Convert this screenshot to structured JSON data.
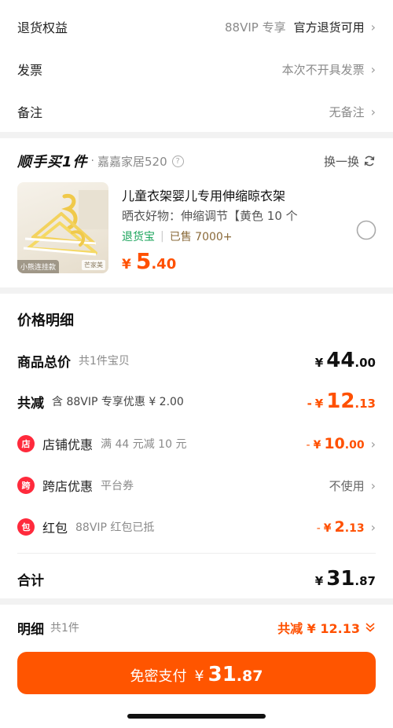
{
  "info": {
    "rows": [
      {
        "label": "退货权益",
        "grey": "88VIP 专享",
        "dark": "官方退货可用"
      },
      {
        "label": "发票",
        "grey": "本次不开具发票"
      },
      {
        "label": "备注",
        "grey": "无备注"
      }
    ]
  },
  "shunshou": {
    "title": "顺手买1件",
    "dot": "·",
    "shop": "嘉嘉家居520",
    "help": "?",
    "switch_label": "换一换",
    "product": {
      "title": "儿童衣架婴儿专用伸缩晾衣架",
      "subtitle": "晒衣好物：伸缩调节【黄色 10 个",
      "img_tag_left": "小熊连挂款",
      "img_tag_right": "芒家美",
      "tag_return": "退货宝",
      "tag_sep": "|",
      "tag_sold": "已售 7000+",
      "price_currency": "¥",
      "price_int": "5",
      "price_dec": ".40"
    }
  },
  "price_detail": {
    "title": "价格明细",
    "total": {
      "label": "商品总价",
      "sub": "共1件宝贝",
      "cur": "¥",
      "int": "44",
      "dec": ".00"
    },
    "reduce": {
      "label": "共减",
      "sub": "含 88VIP 专享优惠 ¥ 2.00",
      "minus": "-",
      "cur": "¥",
      "int": "12",
      "dec": ".13"
    },
    "shop_discount": {
      "icon": "店",
      "label": "店铺优惠",
      "sub": "满 44 元减 10 元",
      "minus": "-",
      "cur": "¥",
      "int": "10",
      "dec": ".00"
    },
    "cross_discount": {
      "icon": "跨",
      "label": "跨店优惠",
      "sub": "平台券",
      "right": "不使用"
    },
    "red_packet": {
      "icon": "包",
      "label": "红包",
      "sub": "88VIP 红包已抵",
      "minus": "-",
      "cur": "¥",
      "int": "2",
      "dec": ".13"
    },
    "sum": {
      "label": "合计",
      "cur": "¥",
      "int": "31",
      "dec": ".87"
    }
  },
  "bottom": {
    "detail_label": "明细",
    "detail_count": "共1件",
    "reduce_text": "共减 ¥ 12.13",
    "pay_label": "免密支付",
    "pay_cur": "¥",
    "pay_int": "31",
    "pay_dec": ".87"
  },
  "colors": {
    "accent": "#ff5000",
    "button": "#ff5500",
    "green": "#19a35a",
    "red_icon": "#ff2a3c"
  }
}
